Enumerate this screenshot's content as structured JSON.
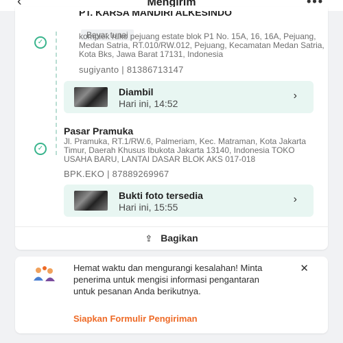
{
  "header": {
    "title": "Mengirim",
    "back_icon": "arrow-left-icon",
    "more_icon": "more-dots-icon"
  },
  "pickup": {
    "name": "PT. KARSA MANDIRI ALKESINDO",
    "payment_badge": "Bayar tunai",
    "address": "komplek ruko pejuang estate blok P1 No. 15A, 16, 16A, Pejuang, Medan Satria, RT.010/RW.012, Pejuang, Kecamatan Medan Satria, Kota Bks, Jawa Barat 17131, Indonesia",
    "contact": "sugiyanto | 81386713147",
    "status": {
      "title": "Diambil",
      "time": "Hari ini, 14:52"
    }
  },
  "dropoff": {
    "name": "Pasar Pramuka",
    "address": "Jl. Pramuka, RT.1/RW.6, Palmeriam, Kec. Matraman, Kota Jakarta Timur, Daerah Khusus Ibukota Jakarta 13140, Indonesia TOKO USAHA BARU, LANTAI DASAR BLOK AKS 017-018",
    "contact": "BPK.EKO | 87889269967",
    "status": {
      "title": "Bukti foto tersedia",
      "time": "Hari ini, 15:55"
    }
  },
  "share_label": "Bagikan",
  "info": {
    "text": "Hemat waktu dan mengurangi kesalahan! Minta penerima untuk mengisi informasi pengantaran untuk pesanan Anda berikutnya.",
    "link": "Siapkan Formulir Pengiriman"
  },
  "colors": {
    "accent_green": "#38b48c",
    "status_bg": "#e8f6f2",
    "link_orange": "#ee6a26"
  }
}
